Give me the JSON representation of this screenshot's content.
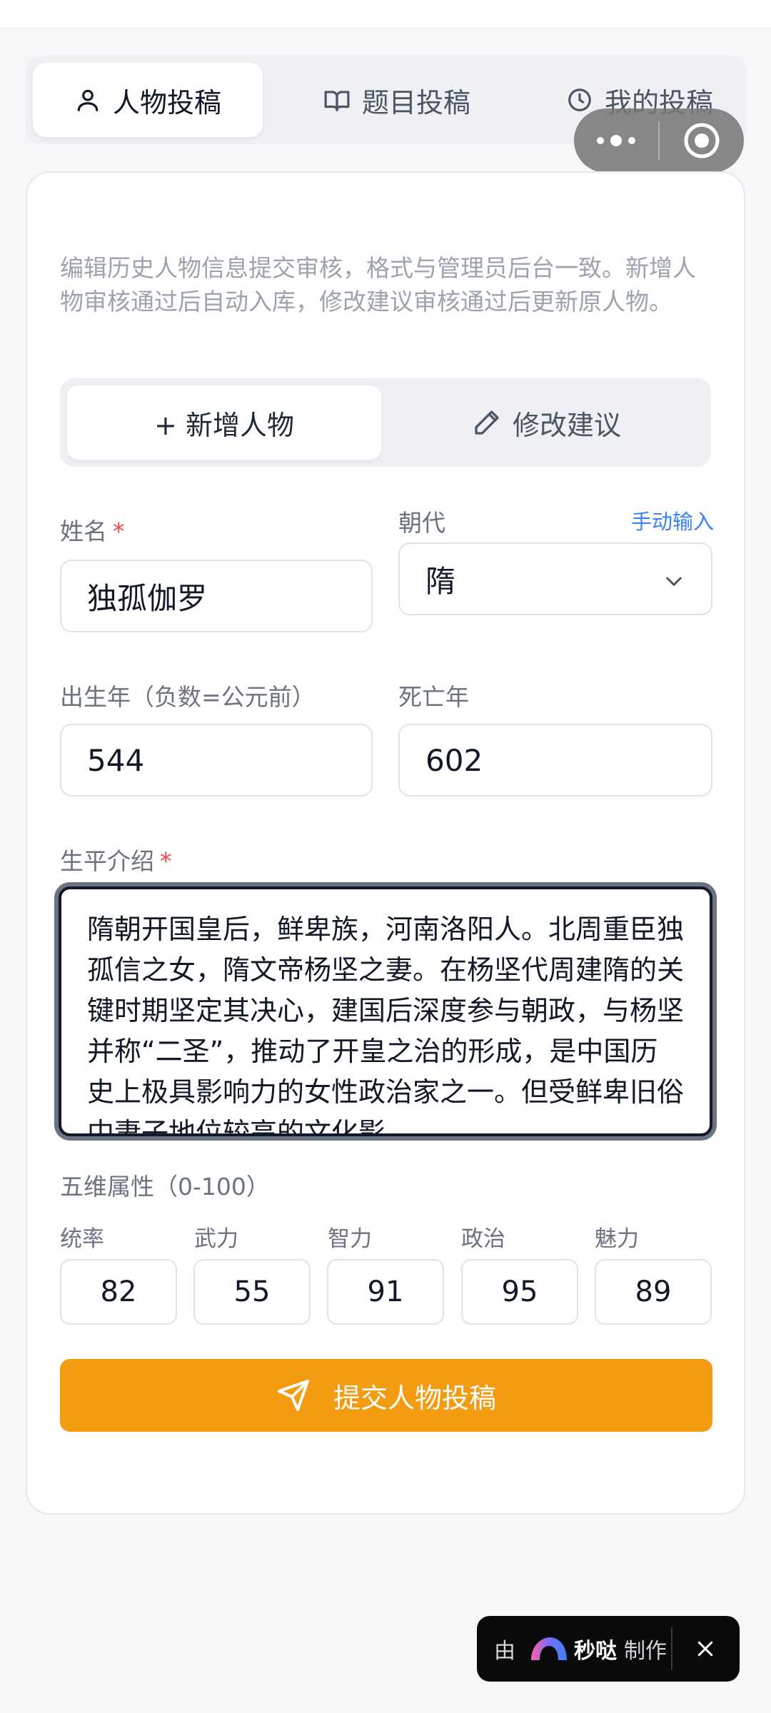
{
  "tabs": [
    {
      "label": "人物投稿",
      "icon": "user-icon",
      "active": true
    },
    {
      "label": "题目投稿",
      "icon": "book-icon",
      "active": false
    },
    {
      "label": "我的投稿",
      "icon": "clock-icon",
      "active": false
    }
  ],
  "intro": "编辑历史人物信息提交审核，格式与管理员后台一致。新增人物审核通过后自动入库，修改建议审核通过后更新原人物。",
  "mode": {
    "add_label": "+ 新增人物",
    "edit_label": "修改建议"
  },
  "form": {
    "name_label": "姓名",
    "required_mark": "*",
    "name_value": "独孤伽罗",
    "dynasty_label": "朝代",
    "manual_input_link": "手动输入",
    "dynasty_value": "隋",
    "birth_label": "出生年（负数=公元前）",
    "birth_value": "544",
    "death_label": "死亡年",
    "death_value": "602",
    "bio_label": "生平介绍",
    "bio_value": "隋朝开国皇后，鲜卑族，河南洛阳人。北周重臣独孤信之女，隋文帝杨坚之妻。在杨坚代周建隋的关键时期坚定其决心，建国后深度参与朝政，与杨坚并称“二圣”，推动了开皇之治的形成，是中国历史上极具影响力的女性政治家之一。但受鲜卑旧俗中妻子地位较高的文化影"
  },
  "attributes": {
    "title": "五维属性（0-100）",
    "items": [
      {
        "label": "统率",
        "value": "82"
      },
      {
        "label": "武力",
        "value": "55"
      },
      {
        "label": "智力",
        "value": "91"
      },
      {
        "label": "政治",
        "value": "95"
      },
      {
        "label": "魅力",
        "value": "89"
      }
    ]
  },
  "submit_label": "提交人物投稿",
  "badge": {
    "by": "由",
    "brand": "秒哒",
    "make": "制作"
  },
  "colors": {
    "accent": "#f39c12",
    "link": "#3b82f6",
    "required": "#ef4444"
  }
}
